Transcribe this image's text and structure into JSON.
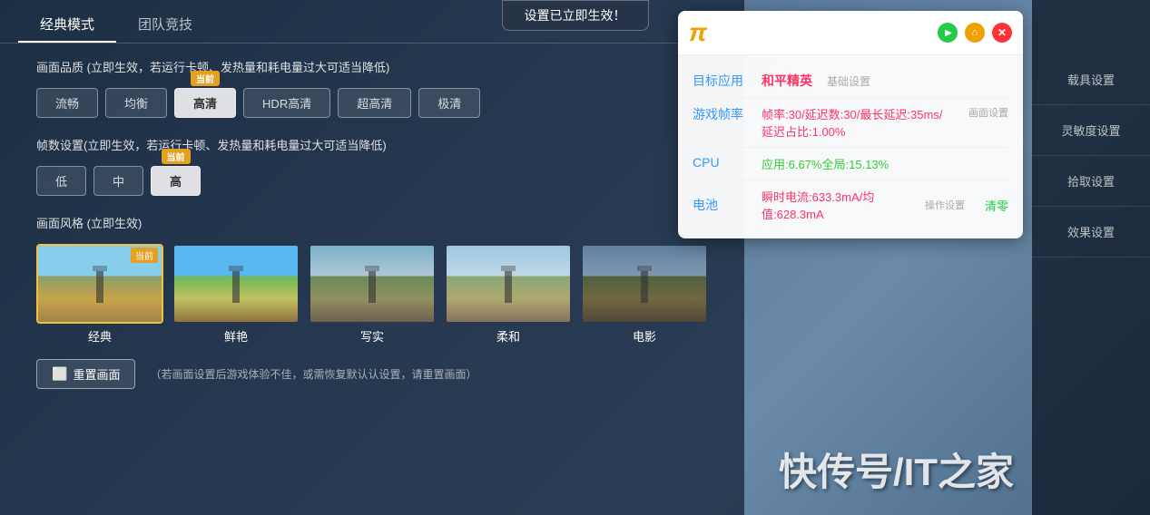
{
  "notification": {
    "text": "设置已立即生效！"
  },
  "tabs": [
    {
      "id": "classic",
      "label": "经典模式",
      "active": true
    },
    {
      "id": "team",
      "label": "团队竞技",
      "active": false
    }
  ],
  "quality_section": {
    "title": "画面品质 (立即生效，若运行卡顿、发热量和耗电量过大可适当降低)",
    "current_label": "当前",
    "options": [
      {
        "id": "smooth",
        "label": "流畅",
        "selected": false
      },
      {
        "id": "balanced",
        "label": "均衡",
        "selected": false
      },
      {
        "id": "hd",
        "label": "高清",
        "selected": true
      },
      {
        "id": "hdr",
        "label": "HDR高清",
        "selected": false
      },
      {
        "id": "ultra",
        "label": "超高清",
        "selected": false
      },
      {
        "id": "extreme",
        "label": "极清",
        "selected": false
      }
    ]
  },
  "fps_section": {
    "title": "帧数设置(立即生效，若运行卡顿、发热量和耗电量过大可适当降低)",
    "current_label": "当前",
    "options": [
      {
        "id": "low",
        "label": "低",
        "selected": false
      },
      {
        "id": "mid",
        "label": "中",
        "selected": false
      },
      {
        "id": "high",
        "label": "高",
        "selected": true
      }
    ]
  },
  "style_section": {
    "title": "画面风格 (立即生效)",
    "current_label": "当前",
    "styles": [
      {
        "id": "classic",
        "label": "经典",
        "selected": true,
        "class": "thumb-classic"
      },
      {
        "id": "vivid",
        "label": "鲜艳",
        "selected": false,
        "class": "thumb-vivid"
      },
      {
        "id": "realistic",
        "label": "写实",
        "selected": false,
        "class": "thumb-realistic"
      },
      {
        "id": "soft",
        "label": "柔和",
        "selected": false,
        "class": "thumb-soft"
      },
      {
        "id": "cinematic",
        "label": "电影",
        "selected": false,
        "class": "thumb-cinematic"
      }
    ]
  },
  "reset": {
    "button_label": "重置画面",
    "hint": "（若画面设置后游戏体验不佳，或需恢复默认认设置，请重置画面）"
  },
  "sidebar": {
    "items": [
      {
        "id": "vehicle",
        "label": "载具设置",
        "active": false
      },
      {
        "id": "sensitivity",
        "label": "灵敏度设置",
        "active": false
      },
      {
        "id": "pickup",
        "label": "拾取设置",
        "active": false
      },
      {
        "id": "effects",
        "label": "效果设置",
        "active": false
      }
    ]
  },
  "tt_panel": {
    "logo": "π",
    "target_label": "目标应用",
    "target_value": "和平精英",
    "target_sub": "基础设置",
    "fps_label": "游戏帧率",
    "fps_value": "帧率:30/延迟数:30/最长延迟:35ms/延迟占比:1.00%",
    "fps_sub": "画面设置",
    "cpu_label": "CPU",
    "cpu_value": "应用:6.67%全局:15.13%",
    "battery_label": "电池",
    "battery_value": "瞬时电流:633.3mA/均值:628.3mA",
    "battery_sub": "操作设置",
    "clear_label": "清零",
    "play_icon": "▶",
    "home_icon": "⌂",
    "close_icon": "✕"
  },
  "watermark": "快传号/IT之家"
}
